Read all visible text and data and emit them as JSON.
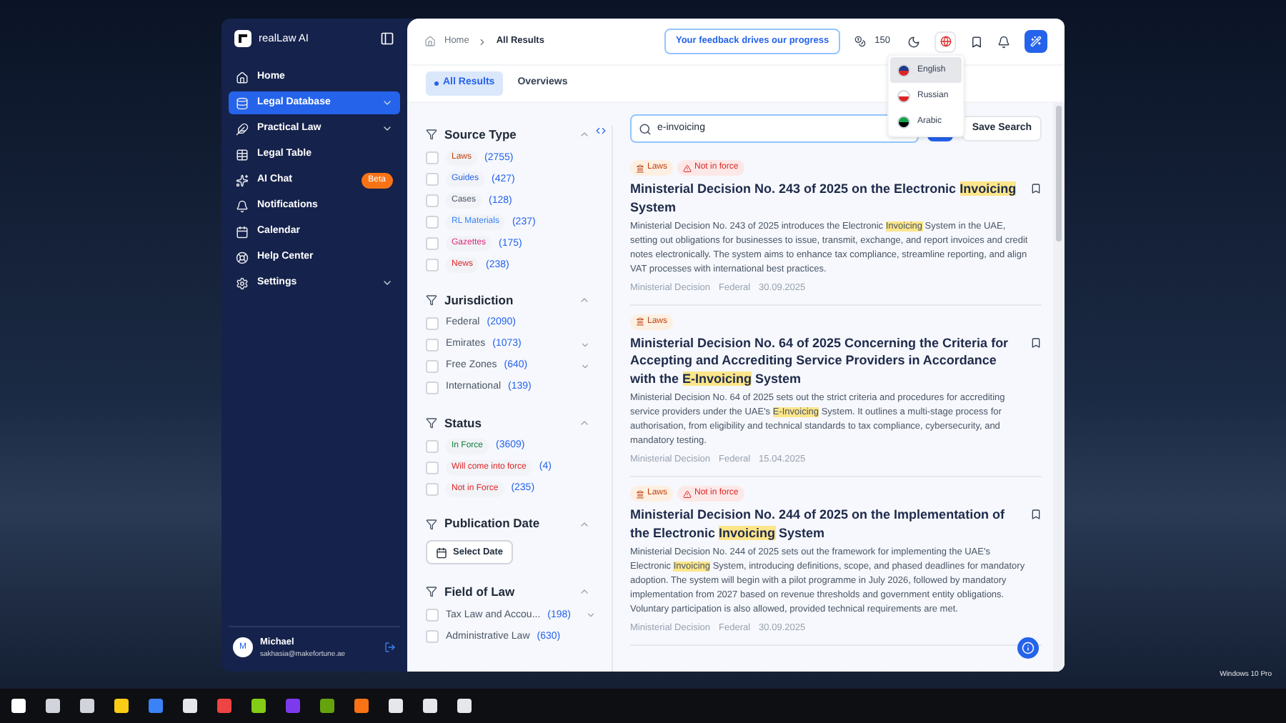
{
  "app": {
    "name": "realLaw AI"
  },
  "sidebar": {
    "items": [
      {
        "label": "Home",
        "selected": false,
        "expandable": false
      },
      {
        "label": "Legal Database",
        "selected": true,
        "expandable": true
      },
      {
        "label": "Practical Law",
        "selected": false,
        "expandable": true
      },
      {
        "label": "Legal Table",
        "selected": false,
        "expandable": false
      },
      {
        "label": "AI Chat",
        "selected": false,
        "expandable": false,
        "badge": "Beta"
      },
      {
        "label": "Notifications",
        "selected": false,
        "expandable": false
      },
      {
        "label": "Calendar",
        "selected": false,
        "expandable": false
      },
      {
        "label": "Help Center",
        "selected": false,
        "expandable": false
      },
      {
        "label": "Settings",
        "selected": false,
        "expandable": true
      }
    ],
    "user": {
      "initial": "M",
      "name": "Michael",
      "email": "sakhasia@makefortune.ae"
    }
  },
  "breadcrumb": [
    "Home",
    "All Results"
  ],
  "header": {
    "feedback": "Your feedback drives our progress",
    "credits": "150"
  },
  "language_menu": [
    {
      "label": "English",
      "selected": true
    },
    {
      "label": "Russian",
      "selected": false
    },
    {
      "label": "Arabic",
      "selected": false
    }
  ],
  "tabs": [
    {
      "label": "All Results",
      "selected": true
    },
    {
      "label": "Overviews",
      "selected": false
    }
  ],
  "filters": [
    {
      "title": "Source Type",
      "kind": "tags",
      "options": [
        {
          "label": "Laws",
          "count": "(2755)",
          "color": "#c2410c",
          "checked": false
        },
        {
          "label": "Guides",
          "count": "(427)",
          "color": "#2563eb",
          "checked": false
        },
        {
          "label": "Cases",
          "count": "(128)",
          "color": "#4b5563",
          "checked": false
        },
        {
          "label": "RL Materials",
          "count": "(237)",
          "color": "#3b82f6",
          "checked": false
        },
        {
          "label": "Gazettes",
          "count": "(175)",
          "color": "#db2777",
          "checked": false
        },
        {
          "label": "News",
          "count": "(238)",
          "color": "#dc2626",
          "checked": false
        }
      ]
    },
    {
      "title": "Jurisdiction",
      "kind": "plain",
      "options": [
        {
          "label": "Federal",
          "count": "(2090)",
          "checked": false,
          "expandable": false
        },
        {
          "label": "Emirates",
          "count": "(1073)",
          "checked": false,
          "expandable": true
        },
        {
          "label": "Free Zones",
          "count": "(640)",
          "checked": false,
          "expandable": true
        },
        {
          "label": "International",
          "count": "(139)",
          "checked": false,
          "expandable": false
        }
      ]
    },
    {
      "title": "Status",
      "kind": "tags",
      "options": [
        {
          "label": "In Force",
          "count": "(3609)",
          "color": "#15803d",
          "checked": false
        },
        {
          "label": "Will come into force",
          "count": "(4)",
          "color": "#dc2626",
          "checked": false
        },
        {
          "label": "Not in Force",
          "count": "(235)",
          "color": "#dc2626",
          "checked": false
        }
      ]
    },
    {
      "title": "Publication Date",
      "kind": "date",
      "button": "Select Date"
    },
    {
      "title": "Field of Law",
      "kind": "plain",
      "options": [
        {
          "label": "Tax Law and Accou...",
          "count": "(198)",
          "checked": false,
          "expandable": true
        },
        {
          "label": "Administrative Law",
          "count": "(630)",
          "checked": false,
          "expandable": false
        }
      ]
    }
  ],
  "search": {
    "value": "e-invoicing",
    "save": "Save Search"
  },
  "results": [
    {
      "tags": [
        {
          "label": "Laws",
          "kind": "type"
        },
        {
          "label": "Not in force",
          "kind": "status"
        }
      ],
      "title": [
        {
          "text": "Ministerial Decision No. 243 of 2025 on the Electronic ",
          "hl": false
        },
        {
          "text": "Invoicing",
          "hl": true
        },
        {
          "text": " System",
          "hl": false
        }
      ],
      "summary": [
        {
          "text": "Ministerial Decision No. 243 of 2025 introduces the Electronic ",
          "hl": false
        },
        {
          "text": "Invoicing",
          "hl": true
        },
        {
          "text": " System in the UAE, setting out obligations for businesses to issue, transmit, exchange, and report invoices and credit notes electronically. The system aims to enhance tax compliance, streamline reporting, and align VAT processes with international best practices.",
          "hl": false
        }
      ],
      "meta": [
        "Ministerial Decision",
        "Federal",
        "30.09.2025"
      ]
    },
    {
      "tags": [
        {
          "label": "Laws",
          "kind": "type"
        }
      ],
      "title": [
        {
          "text": "Ministerial Decision No. 64 of 2025 Concerning the Criteria for Accepting and Accrediting Service Providers in Accordance with the ",
          "hl": false
        },
        {
          "text": "E-Invoicing",
          "hl": true
        },
        {
          "text": " System",
          "hl": false
        }
      ],
      "summary": [
        {
          "text": "Ministerial Decision No. 64 of 2025 sets out the strict criteria and procedures for accrediting service providers under the UAE's ",
          "hl": false
        },
        {
          "text": "E-Invoicing",
          "hl": true
        },
        {
          "text": " System. It outlines a multi-stage process for authorisation, from eligibility and technical standards to tax compliance, cybersecurity, and mandatory testing.",
          "hl": false
        }
      ],
      "meta": [
        "Ministerial Decision",
        "Federal",
        "15.04.2025"
      ]
    },
    {
      "tags": [
        {
          "label": "Laws",
          "kind": "type"
        },
        {
          "label": "Not in force",
          "kind": "status"
        }
      ],
      "title": [
        {
          "text": "Ministerial Decision No. 244 of 2025 on the Implementation of the Electronic ",
          "hl": false
        },
        {
          "text": "Invoicing",
          "hl": true
        },
        {
          "text": " System",
          "hl": false
        }
      ],
      "summary": [
        {
          "text": "Ministerial Decision No. 244 of 2025 sets out the framework for implementing the UAE's Electronic ",
          "hl": false
        },
        {
          "text": "Invoicing",
          "hl": true
        },
        {
          "text": " System, introducing definitions, scope, and phased deadlines for mandatory adoption. The system will begin with a pilot programme in July 2026, followed by mandatory implementation from 2027 based on revenue thresholds and government entity obligations. Voluntary participation is also allowed, provided technical requirements are met.",
          "hl": false
        }
      ],
      "meta": [
        "Ministerial Decision",
        "Federal",
        "30.09.2025"
      ]
    }
  ],
  "desktop": {
    "notice": "Windows 10 Pro"
  }
}
